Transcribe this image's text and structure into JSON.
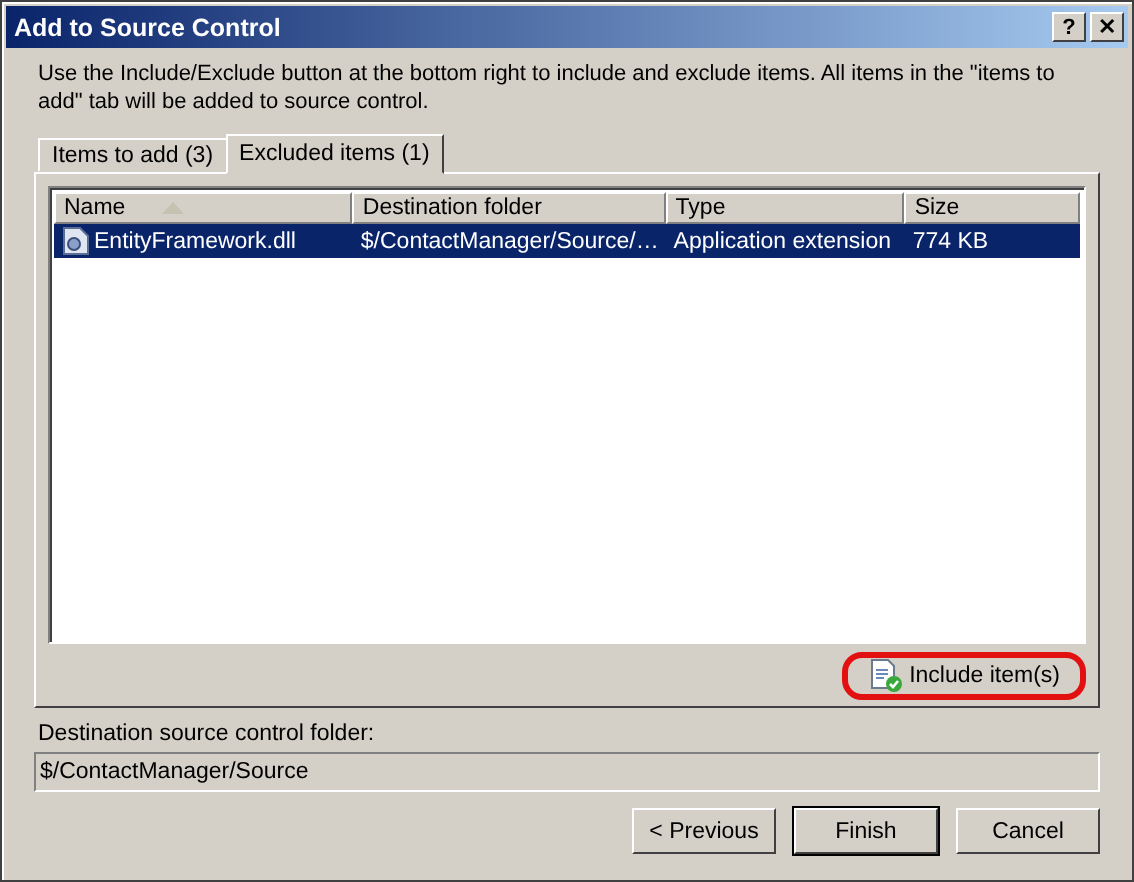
{
  "window": {
    "title": "Add to Source Control",
    "controls": [
      "?",
      "✕"
    ]
  },
  "description": "Use the Include/Exclude button at the bottom right to include and exclude items. All items in the \"items to add\" tab will be added to source control.",
  "tabs": [
    {
      "label": "Items to add (3)",
      "selected": false
    },
    {
      "label": "Excluded items (1)",
      "selected": true
    }
  ],
  "table": {
    "columns": [
      {
        "label": "Name",
        "sorted": true
      },
      {
        "label": "Destination folder",
        "sorted": false
      },
      {
        "label": "Type",
        "sorted": false
      },
      {
        "label": "Size",
        "sorted": false
      }
    ],
    "rows": [
      {
        "cells": [
          "EntityFramework.dll",
          "$/ContactManager/Source/…",
          "Application extension",
          "774 KB"
        ],
        "selected": true
      }
    ]
  },
  "include_button": {
    "label": "Include item(s)",
    "highlighted": true
  },
  "destination": {
    "label": "Destination source control folder:",
    "value": "$/ContactManager/Source"
  },
  "buttons": [
    {
      "label": "< Previous",
      "default": false
    },
    {
      "label": "Finish",
      "default": true
    },
    {
      "label": "Cancel",
      "default": false
    }
  ]
}
